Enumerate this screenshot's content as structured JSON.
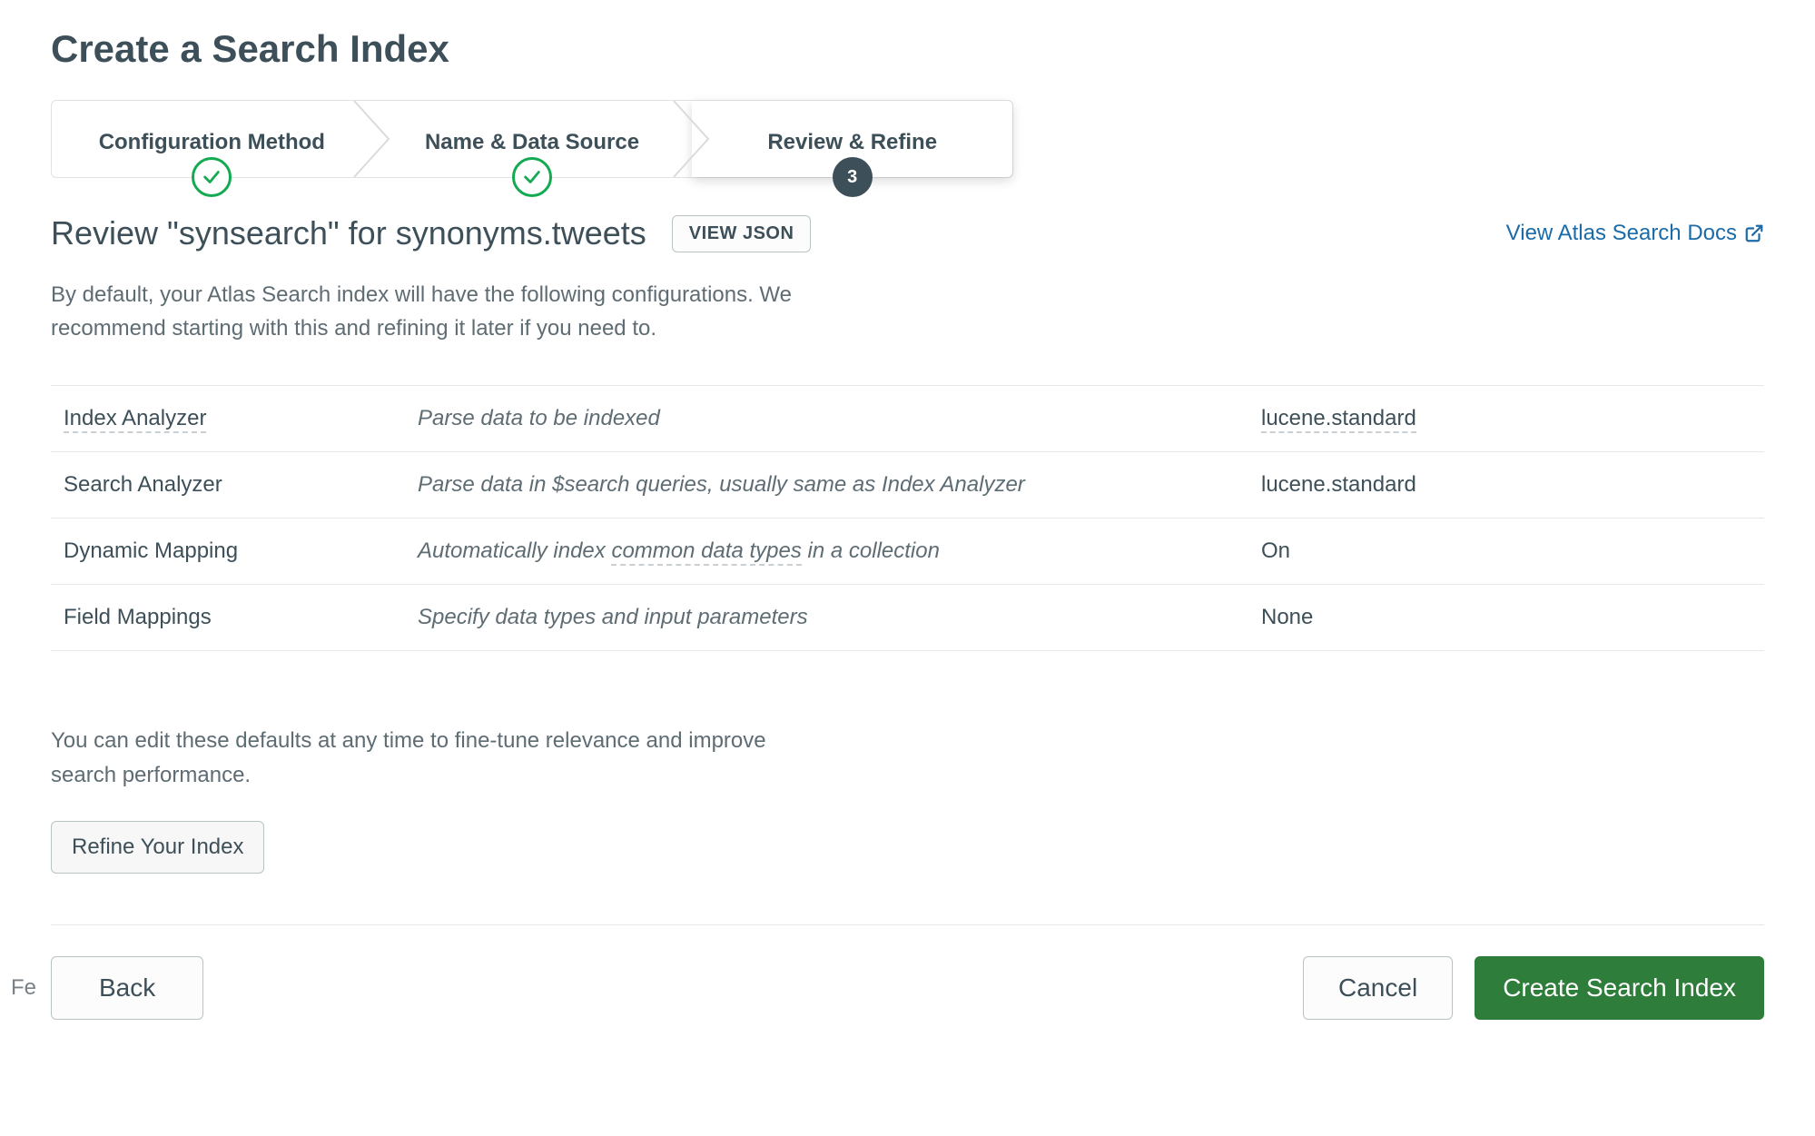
{
  "page_title": "Create a Search Index",
  "stepper": {
    "steps": [
      {
        "label": "Configuration Method",
        "state": "done"
      },
      {
        "label": "Name & Data Source",
        "state": "done"
      },
      {
        "label": "Review & Refine",
        "state": "active",
        "num": "3"
      }
    ]
  },
  "subheader": {
    "title": "Review \"synsearch\" for synonyms.tweets",
    "view_json_label": "VIEW JSON",
    "docs_link_label": "View Atlas Search Docs"
  },
  "intro_text": "By default, your Atlas Search index will have the following configurations. We recommend starting with this and refining it later if you need to.",
  "config": {
    "rows": [
      {
        "label": "Index Analyzer",
        "description": "Parse data to be indexed",
        "value": "lucene.standard",
        "label_dotted": true,
        "value_dotted": true
      },
      {
        "label": "Search Analyzer",
        "description": "Parse data in $search queries, usually same as Index Analyzer",
        "value": "lucene.standard",
        "label_dotted": false,
        "value_dotted": false
      },
      {
        "label": "Dynamic Mapping",
        "description": "Automatically index common data types in a collection",
        "value": "On",
        "label_dotted": false,
        "desc_dotted": true,
        "value_dotted": false
      },
      {
        "label": "Field Mappings",
        "description": "Specify data types and input parameters",
        "value": "None",
        "label_dotted": false,
        "value_dotted": false
      }
    ]
  },
  "more_text": "You can edit these defaults at any time to fine-tune relevance and improve search performance.",
  "refine_label": "Refine Your Index",
  "footer": {
    "back_label": "Back",
    "cancel_label": "Cancel",
    "create_label": "Create Search Index",
    "feedback_fragment": "Fe"
  }
}
